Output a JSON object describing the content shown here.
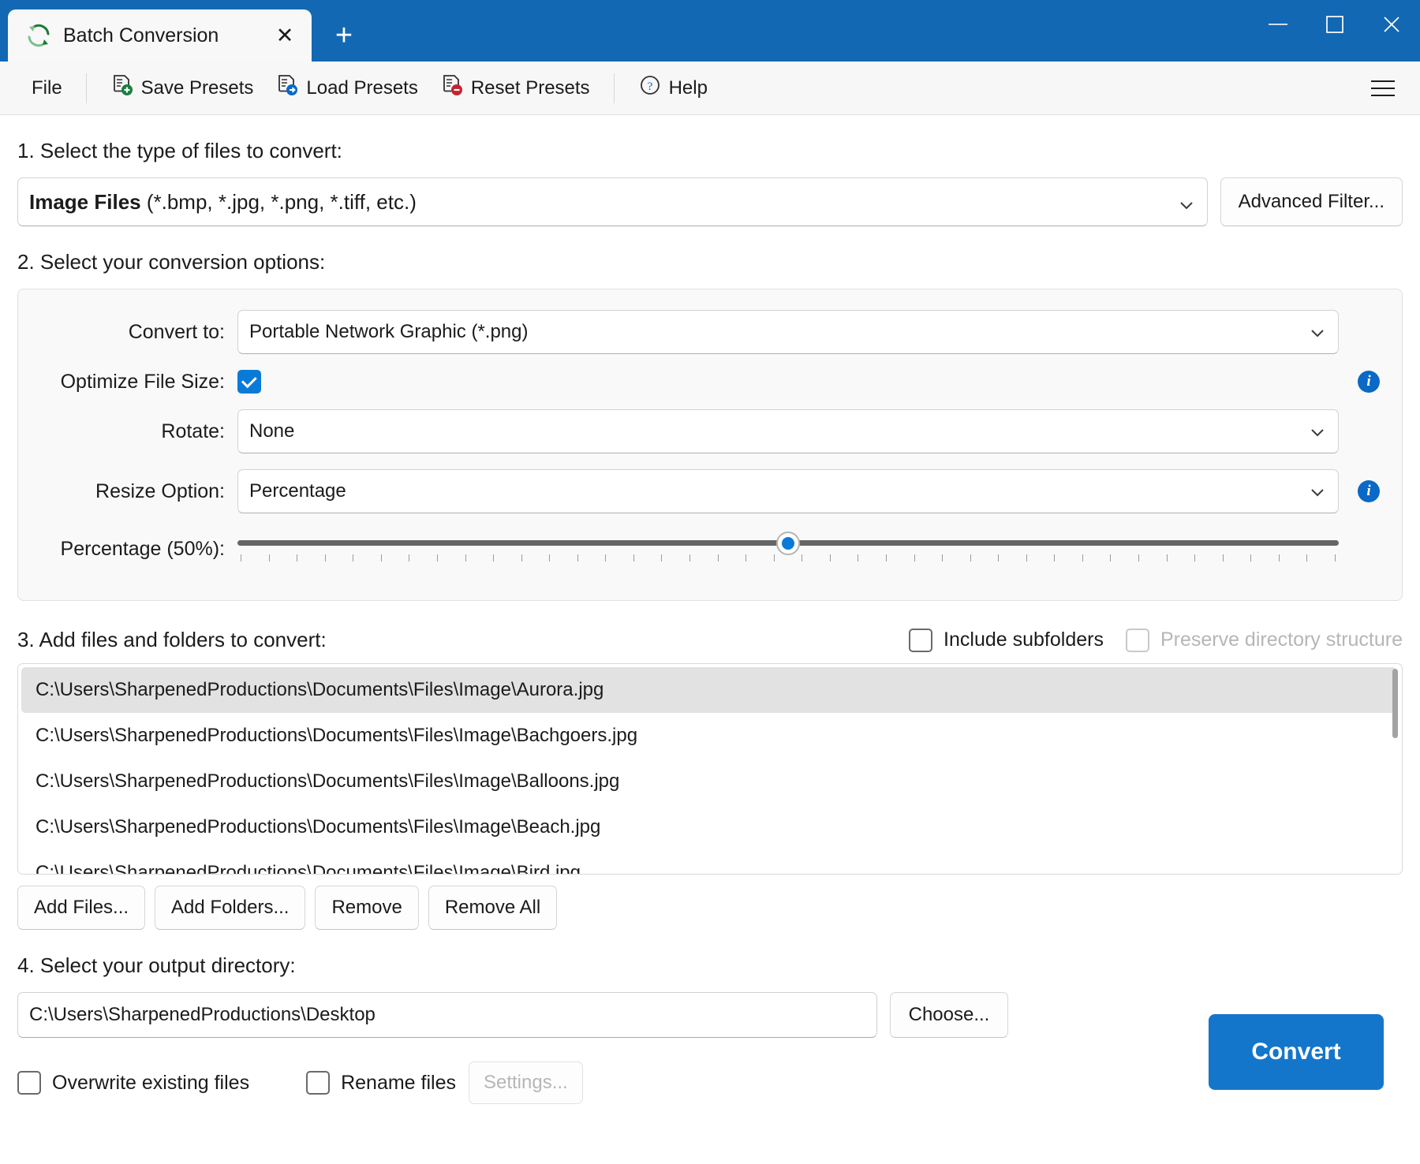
{
  "window": {
    "tab_title": "Batch Conversion",
    "tab_icon": "refresh-convert-icon",
    "close_tab_glyph": "✕",
    "new_tab_glyph": "+",
    "minimize_glyph": "—",
    "maximize_glyph": "▢",
    "close_glyph": "✕",
    "accent_color": "#1268b3"
  },
  "menubar": {
    "file": "File",
    "save_presets": "Save Presets",
    "load_presets": "Load Presets",
    "reset_presets": "Reset Presets",
    "help": "Help"
  },
  "step1": {
    "label": "1. Select the type of files to convert:",
    "filetype_bold": "Image Files",
    "filetype_rest": " (*.bmp, *.jpg, *.png, *.tiff, etc.)",
    "advanced_filter": "Advanced Filter..."
  },
  "step2": {
    "label": "2. Select your conversion options:",
    "convert_to_label": "Convert to:",
    "convert_to_value": "Portable Network Graphic (*.png)",
    "optimize_label": "Optimize File Size:",
    "optimize_checked": true,
    "rotate_label": "Rotate:",
    "rotate_value": "None",
    "resize_label": "Resize Option:",
    "resize_value": "Percentage",
    "percentage_label": "Percentage (50%):",
    "percentage_value": 50,
    "info_glyph": "i"
  },
  "step3": {
    "label": "3. Add files and folders to convert:",
    "include_subfolders": "Include subfolders",
    "include_subfolders_checked": false,
    "preserve_structure": "Preserve directory structure",
    "preserve_structure_checked": false,
    "preserve_structure_disabled": true,
    "files": [
      "C:\\Users\\SharpenedProductions\\Documents\\Files\\Image\\Aurora.jpg",
      "C:\\Users\\SharpenedProductions\\Documents\\Files\\Image\\Bachgoers.jpg",
      "C:\\Users\\SharpenedProductions\\Documents\\Files\\Image\\Balloons.jpg",
      "C:\\Users\\SharpenedProductions\\Documents\\Files\\Image\\Beach.jpg",
      "C:\\Users\\SharpenedProductions\\Documents\\Files\\Image\\Bird.jpg"
    ],
    "selected_index": 0,
    "add_files": "Add Files...",
    "add_folders": "Add Folders...",
    "remove": "Remove",
    "remove_all": "Remove All"
  },
  "step4": {
    "label": "4. Select your output directory:",
    "output_path": "C:\\Users\\SharpenedProductions\\Desktop",
    "choose": "Choose...",
    "overwrite_label": "Overwrite existing files",
    "overwrite_checked": false,
    "rename_label": "Rename files",
    "rename_checked": false,
    "settings": "Settings..."
  },
  "actions": {
    "convert": "Convert"
  }
}
